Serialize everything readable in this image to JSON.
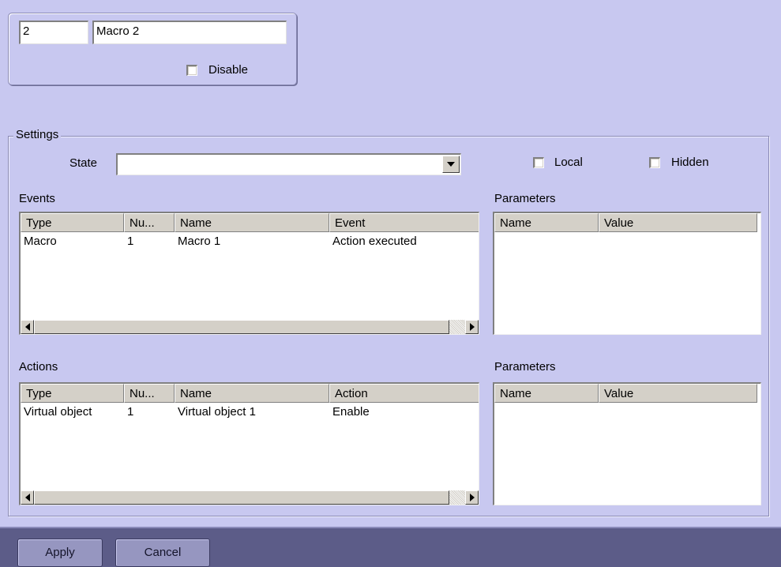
{
  "object": {
    "id": "2",
    "name": "Macro 2",
    "disable_label": "Disable",
    "disable_checked": false
  },
  "settings": {
    "title": "Settings",
    "state_label": "State",
    "state_value": "",
    "local_label": "Local",
    "local_checked": false,
    "hidden_label": "Hidden",
    "hidden_checked": false
  },
  "events": {
    "title": "Events",
    "columns": [
      "Type",
      "Nu...",
      "Name",
      "Event"
    ],
    "rows": [
      [
        "Macro",
        "1",
        "Macro 1",
        "Action executed"
      ]
    ]
  },
  "events_parameters": {
    "title": "Parameters",
    "columns": [
      "Name",
      "Value"
    ]
  },
  "actions": {
    "title": "Actions",
    "columns": [
      "Type",
      "Nu...",
      "Name",
      "Action"
    ],
    "rows": [
      [
        "Virtual object",
        "1",
        "Virtual object 1",
        "Enable"
      ]
    ]
  },
  "actions_parameters": {
    "title": "Parameters",
    "columns": [
      "Name",
      "Value"
    ]
  },
  "footer": {
    "apply_label": "Apply",
    "cancel_label": "Cancel"
  }
}
